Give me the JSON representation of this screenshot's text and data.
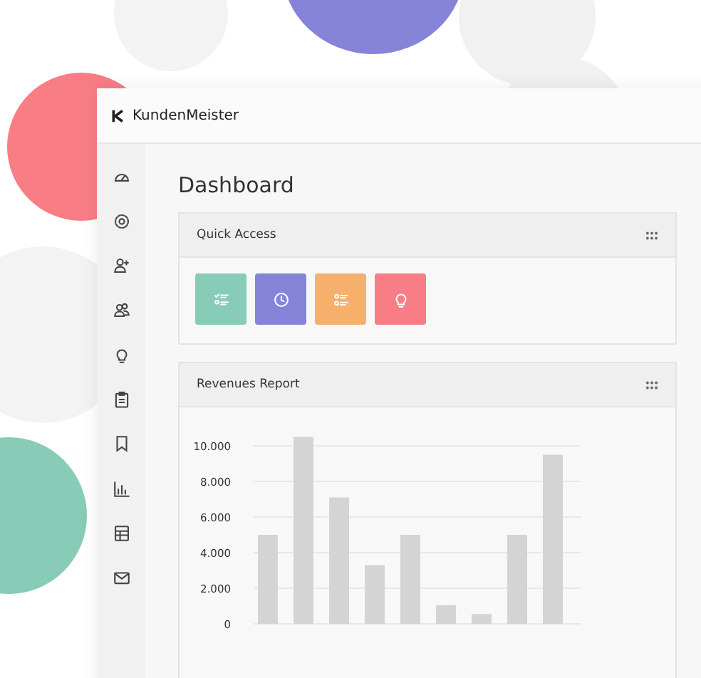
{
  "app": {
    "name": "KundenMeister"
  },
  "sidebar": {
    "items": [
      {
        "kind": "gauge"
      },
      {
        "kind": "gear"
      },
      {
        "kind": "user-plus"
      },
      {
        "kind": "users"
      },
      {
        "kind": "bulb"
      },
      {
        "kind": "clipboard"
      },
      {
        "kind": "bookmark"
      },
      {
        "kind": "chart"
      },
      {
        "kind": "table"
      },
      {
        "kind": "mail"
      }
    ]
  },
  "page": {
    "title": "Dashboard"
  },
  "quick_access": {
    "title": "Quick Access",
    "buttons": [
      {
        "kind": "checklist",
        "color": "#88cbb7"
      },
      {
        "kind": "clock",
        "color": "#8584d9"
      },
      {
        "kind": "list",
        "color": "#f6b06c"
      },
      {
        "kind": "bulb",
        "color": "#f97d85"
      }
    ]
  },
  "revenues": {
    "title": "Revenues Report",
    "chart_data": {
      "type": "bar",
      "values": [
        5000,
        10500,
        7100,
        3300,
        5000,
        1050,
        550,
        5000,
        9500
      ],
      "ylim": [
        0,
        10500
      ],
      "grid": true,
      "yticks": [
        {
          "value": 0,
          "label": "0"
        },
        {
          "value": 2000,
          "label": "2.000"
        },
        {
          "value": 4000,
          "label": "4.000"
        },
        {
          "value": 6000,
          "label": "6.000"
        },
        {
          "value": 8000,
          "label": "8.000"
        },
        {
          "value": 10000,
          "label": "10.000"
        }
      ]
    }
  }
}
